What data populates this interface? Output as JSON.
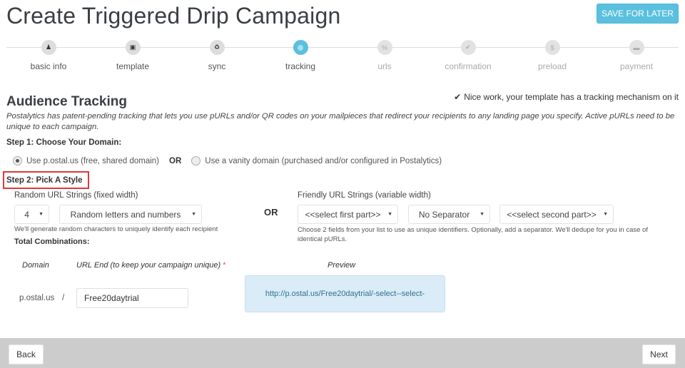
{
  "header": {
    "title": "Create Triggered Drip Campaign",
    "save_label": "SAVE FOR LATER"
  },
  "wizard": {
    "active_step": "tracking",
    "steps": [
      {
        "label": "basic info",
        "icon": "user-icon",
        "glyph": "♟",
        "state": "done"
      },
      {
        "label": "template",
        "icon": "image-icon",
        "glyph": "▣",
        "state": "done"
      },
      {
        "label": "sync",
        "icon": "recycle-icon",
        "glyph": "♻",
        "state": "done"
      },
      {
        "label": "tracking",
        "icon": "target-icon",
        "glyph": "",
        "state": "active"
      },
      {
        "label": "urls",
        "icon": "percent-icon",
        "glyph": "%",
        "state": "future"
      },
      {
        "label": "confirmation",
        "icon": "check-icon",
        "glyph": "✔",
        "state": "future"
      },
      {
        "label": "preload",
        "icon": "dollar-icon",
        "glyph": "$",
        "state": "future"
      },
      {
        "label": "payment",
        "icon": "credit-card-icon",
        "glyph": "▬",
        "state": "future"
      }
    ]
  },
  "tracking": {
    "title": "Audience Tracking",
    "success_note": "Nice work, your template has a tracking mechanism on it",
    "success_icon": "✔",
    "description": "Postalytics has patent-pending tracking that lets you use pURLs and/or QR codes on your mailpieces that redirect your recipients to any landing page you specify. Active pURLs need to be unique to each campaign."
  },
  "step1": {
    "label": "Step 1: Choose Your Domain:",
    "option_shared": "Use p.ostal.us (free, shared domain)",
    "option_shared_checked": true,
    "or": "OR",
    "option_vanity": "Use a vanity domain (purchased and/or configured in Postalytics)",
    "option_vanity_checked": false
  },
  "step2": {
    "label": "Step 2: Pick A Style",
    "random": {
      "label": "Random URL Strings (fixed width)",
      "length_value": "4",
      "charset_value": "Random letters and numbers",
      "help": "We'll generate random characters to uniquely identify each recipient",
      "total_label": "Total Combinations:"
    },
    "or": "OR",
    "friendly": {
      "label": "Friendly URL Strings (variable width)",
      "first_part_value": "<<select first part>>",
      "separator_value": "No Separator",
      "second_part_value": "<<select second part>>",
      "help": "Choose 2 fields from your list to use as unique identifiers. Optionally, add a separator. We'll dedupe for you in case of identical pURLs."
    }
  },
  "url_builder": {
    "domain_header": "Domain",
    "url_end_header": "URL End (to keep your campaign unique)",
    "required_mark": "*",
    "preview_header": "Preview",
    "domain_value": "p.ostal.us",
    "slash": "/",
    "url_end_value": "Free20daytrial",
    "preview_value": "http://p.ostal.us/Free20daytrial/-select--select-"
  },
  "footer": {
    "back_label": "Back",
    "next_label": "Next"
  },
  "colors": {
    "accent": "#5bc0de",
    "highlight_box": "#e0383a",
    "preview_bg": "#d9ecf7",
    "footer_bg": "#cccccc"
  }
}
